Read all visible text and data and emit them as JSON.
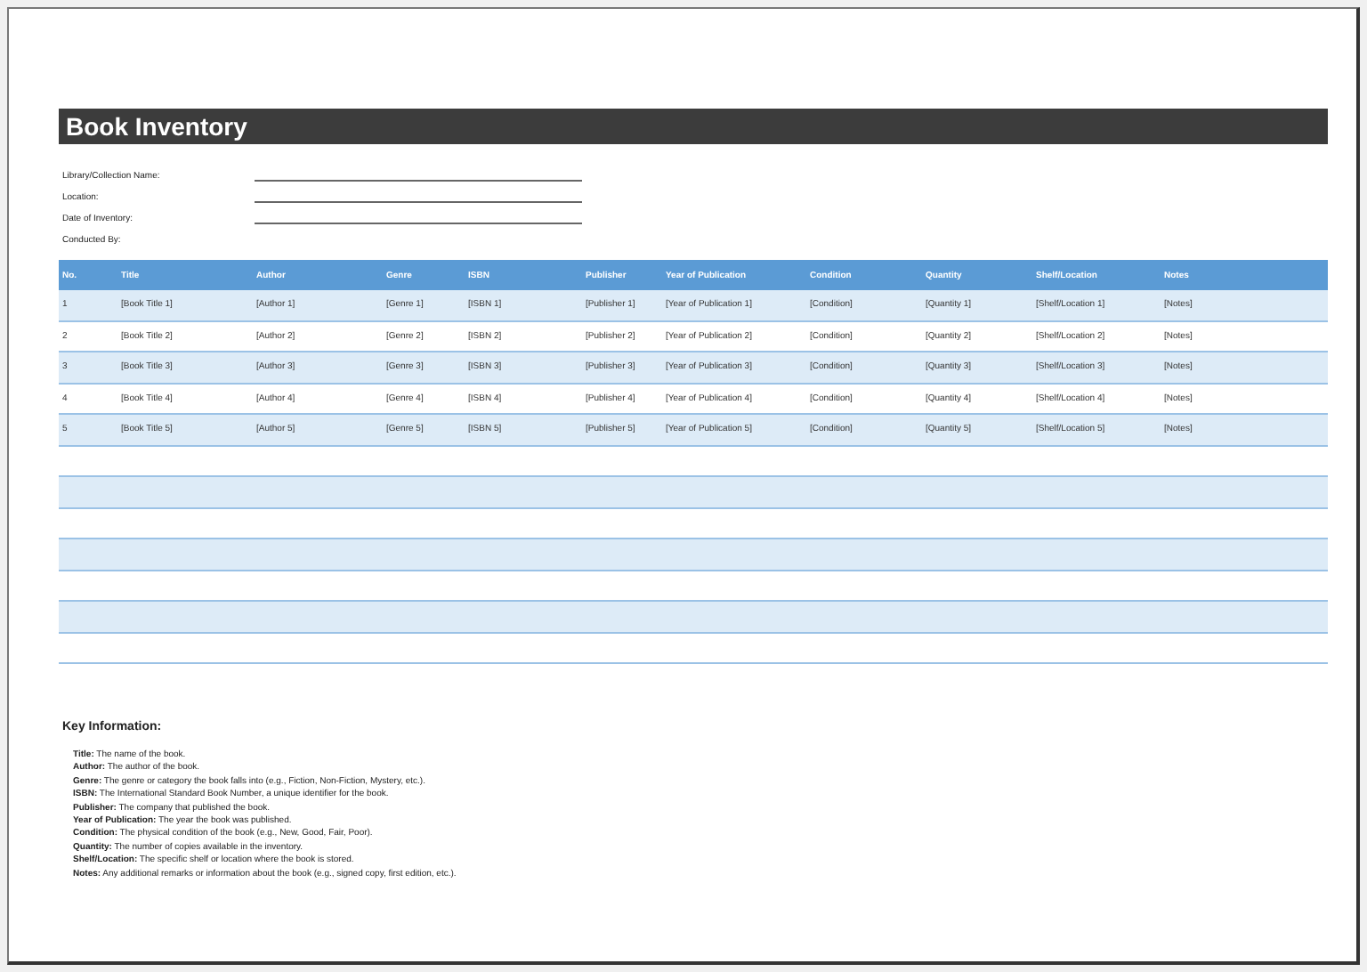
{
  "title": "Book Inventory",
  "fields": [
    {
      "label": "Library/Collection Name:",
      "kind": "line"
    },
    {
      "label": "Location:",
      "kind": "line"
    },
    {
      "label": "Date of Inventory:",
      "kind": "line"
    },
    {
      "label": "Conducted By:",
      "kind": "plain"
    }
  ],
  "table": {
    "columns": [
      "No.",
      "Title",
      "Author",
      "Genre",
      "ISBN",
      "Publisher",
      "Year of Publication",
      "Condition",
      "Quantity",
      "Shelf/Location",
      "Notes"
    ],
    "rows": [
      [
        "1",
        "[Book Title 1]",
        "[Author 1]",
        "[Genre 1]",
        "[ISBN 1]",
        "[Publisher 1]",
        "[Year of Publication 1]",
        "[Condition]",
        "[Quantity 1]",
        "[Shelf/Location 1]",
        "[Notes]"
      ],
      [
        "2",
        "[Book Title 2]",
        "[Author 2]",
        "[Genre 2]",
        "[ISBN 2]",
        "[Publisher 2]",
        "[Year of Publication 2]",
        "[Condition]",
        "[Quantity 2]",
        "[Shelf/Location 2]",
        "[Notes]"
      ],
      [
        "3",
        "[Book Title 3]",
        "[Author 3]",
        "[Genre 3]",
        "[ISBN 3]",
        "[Publisher 3]",
        "[Year of Publication 3]",
        "[Condition]",
        "[Quantity 3]",
        "[Shelf/Location 3]",
        "[Notes]"
      ],
      [
        "4",
        "[Book Title 4]",
        "[Author 4]",
        "[Genre 4]",
        "[ISBN 4]",
        "[Publisher 4]",
        "[Year of Publication 4]",
        "[Condition]",
        "[Quantity 4]",
        "[Shelf/Location 4]",
        "[Notes]"
      ],
      [
        "5",
        "[Book Title 5]",
        "[Author 5]",
        "[Genre 5]",
        "[ISBN 5]",
        "[Publisher 5]",
        "[Year of Publication 5]",
        "[Condition]",
        "[Quantity 5]",
        "[Shelf/Location 5]",
        "[Notes]"
      ]
    ]
  },
  "key_information": {
    "heading": "Key Information:",
    "items": [
      "**Title:** The name of the book.",
      "**Author:** The author of the book.",
      "**Genre:** The genre or category the book falls into (e.g., Fiction, Non-Fiction, Mystery, etc.).",
      "**ISBN:** The International Standard Book Number, a unique identifier for the book.",
      "**Publisher:** The company that published the book.",
      "**Year of Publication:** The year the book was published.",
      "**Condition:** The physical condition of the book (e.g., New, Good, Fair, Poor).",
      "**Quantity:** The number of copies available in the inventory.",
      "**Shelf/Location:** The specific shelf or location where the book is stored.",
      "**Notes:** Any additional remarks or information about the book (e.g., signed copy, first edition, etc.)."
    ]
  }
}
